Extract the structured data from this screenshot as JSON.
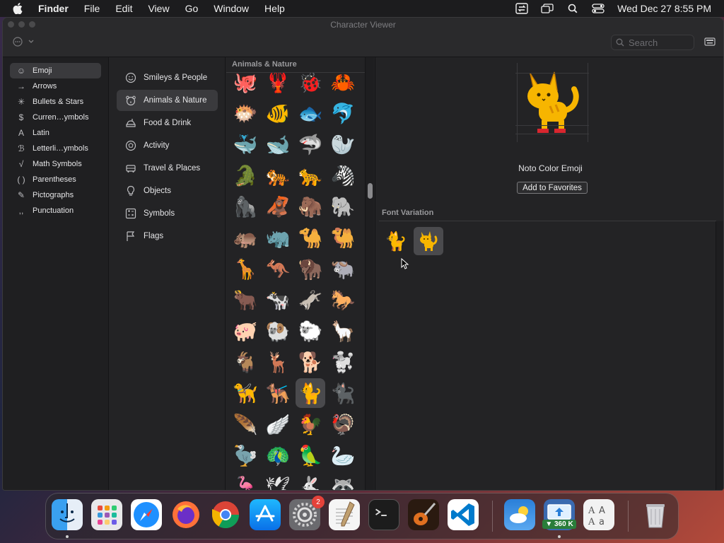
{
  "menubar": {
    "app_name": "Finder",
    "menus": [
      "File",
      "Edit",
      "View",
      "Go",
      "Window",
      "Help"
    ],
    "clock": "Wed Dec 27  8:55 PM"
  },
  "window": {
    "title": "Character Viewer",
    "search_placeholder": "Search"
  },
  "sidebar": {
    "items": [
      {
        "symbol": "☺",
        "label": "Emoji"
      },
      {
        "symbol": "→",
        "label": "Arrows"
      },
      {
        "symbol": "✳",
        "label": "Bullets & Stars"
      },
      {
        "symbol": "$",
        "label": "Curren…ymbols"
      },
      {
        "symbol": "A",
        "label": "Latin"
      },
      {
        "symbol": "ℬ",
        "label": "Letterli…ymbols"
      },
      {
        "symbol": "√",
        "label": "Math Symbols"
      },
      {
        "symbol": "( )",
        "label": "Parentheses"
      },
      {
        "symbol": "✎",
        "label": "Pictographs"
      },
      {
        "symbol": ",,",
        "label": "Punctuation"
      }
    ]
  },
  "categories": {
    "items": [
      {
        "icon": "smiley-icon",
        "label": "Smileys & People"
      },
      {
        "icon": "bear-icon",
        "label": "Animals & Nature"
      },
      {
        "icon": "food-icon",
        "label": "Food & Drink"
      },
      {
        "icon": "ball-icon",
        "label": "Activity"
      },
      {
        "icon": "car-icon",
        "label": "Travel & Places"
      },
      {
        "icon": "bulb-icon",
        "label": "Objects"
      },
      {
        "icon": "symbols-icon",
        "label": "Symbols"
      },
      {
        "icon": "flag-icon",
        "label": "Flags"
      }
    ]
  },
  "grid": {
    "header": "Animals & Nature",
    "emojis": [
      "🐙",
      "🦞",
      "🐞",
      "🦀",
      "🐡",
      "🐠",
      "🐟",
      "🐬",
      "🐳",
      "🐋",
      "🦈",
      "🦭",
      "🐊",
      "🐅",
      "🐆",
      "🦓",
      "🦍",
      "🦧",
      "🦣",
      "🐘",
      "🦛",
      "🦏",
      "🐪",
      "🐫",
      "🦒",
      "🦘",
      "🦬",
      "🐃",
      "🐂",
      "🐄",
      "🫏",
      "🐎",
      "🐖",
      "🐏",
      "🐑",
      "🦙",
      "🐐",
      "🦌",
      "🐕",
      "🐩",
      "🦮",
      "🐕‍🦺",
      "🐈",
      "🐈‍⬛",
      "🪶",
      "🪽",
      "🐓",
      "🦃",
      "🦤",
      "🦚",
      "🦜",
      "🦢",
      "🦩",
      "🕊",
      "🐇",
      "🦝"
    ]
  },
  "detail": {
    "preview_emoji": "🐈",
    "font_name": "Noto Color Emoji",
    "favorites_button": "Add to Favorites",
    "font_variation_header": "Font Variation",
    "variations": [
      "🐈",
      "🐈"
    ]
  },
  "dock": {
    "apps": [
      {
        "name": "Finder"
      },
      {
        "name": "Launchpad"
      },
      {
        "name": "Safari"
      },
      {
        "name": "Firefox"
      },
      {
        "name": "Chrome"
      },
      {
        "name": "App Store"
      },
      {
        "name": "System Settings"
      },
      {
        "name": "TextEdit"
      },
      {
        "name": "Terminal"
      },
      {
        "name": "GarageBand"
      },
      {
        "name": "VS Code"
      },
      {
        "name": "Weather"
      },
      {
        "name": "Network Monitor"
      },
      {
        "name": "Font Book"
      },
      {
        "name": "Trash"
      }
    ],
    "settings_badge": "2",
    "network_badge": "▼ 360 K"
  }
}
